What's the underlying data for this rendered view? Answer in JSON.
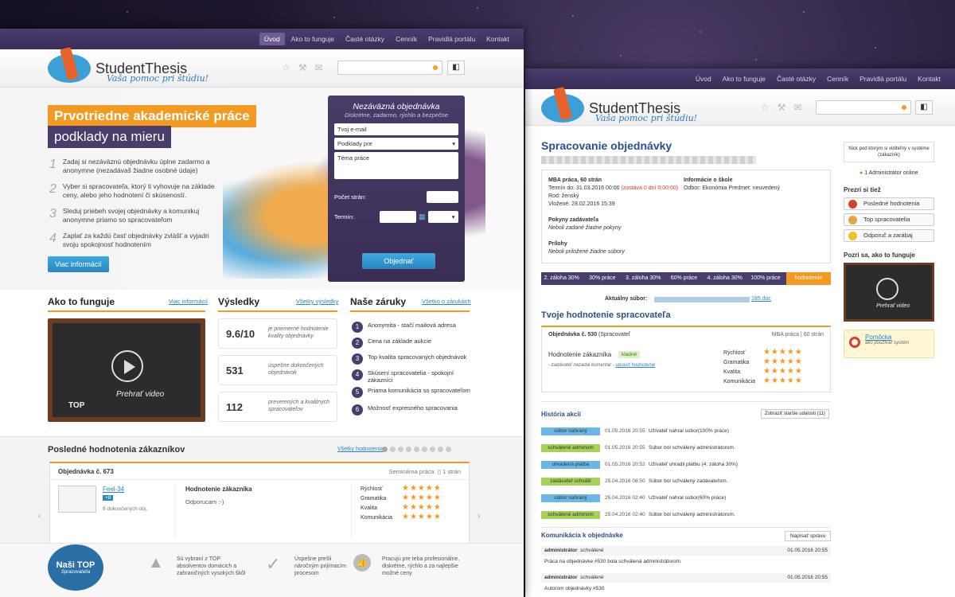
{
  "brand": {
    "name": "StudentThesis",
    "tagline": "Vaša pomoc pri štúdiu!"
  },
  "nav": [
    "Úvod",
    "Ako to funguje",
    "Časté otázky",
    "Cenník",
    "Pravidlá portálu",
    "Kontakt"
  ],
  "hero": {
    "title1": "Prvotriedne akademické práce",
    "title2": "podklady na mieru",
    "steps": [
      {
        "n": "1",
        "text": "Zadaj si nezáväznú objednávku úplne zadarmo a anonymne (nezadávaš žiadne osobné údaje)"
      },
      {
        "n": "2",
        "text": "Vyber si spracovateľa, ktorý ti vyhovuje na základe ceny, alebo jeho hodnotení či skúseností."
      },
      {
        "n": "3",
        "text": "Sleduj priebeh svojej objednávky a komunikuj anonymne priamo so spracovateľom"
      },
      {
        "n": "4",
        "text": "Zaplať za každú časť objednávky zvlášť a vyjadri svoju spokojnosť hodnotením"
      }
    ],
    "more_btn": "Viac informácií"
  },
  "order_form": {
    "title": "Nezáväzná objednávka",
    "subtitle": "Diskrétne, zadarmo, rýchlo a bezpečne",
    "email": "Tvoj e-mail",
    "type": "Podklady pre",
    "topic": "Téma práce",
    "pages_label": "Počet strán:",
    "deadline_label": "Termín:",
    "submit": "Objednať"
  },
  "how": {
    "title": "Ako to funguje",
    "link": "Viac informácií",
    "video_text": "Prehrať video",
    "badge": "TOP"
  },
  "results": {
    "title": "Výsledky",
    "link": "Všetky výsledky",
    "items": [
      {
        "value": "9.6/10",
        "desc": "je priemerné hodnotenie kvality objednávky"
      },
      {
        "value": "531",
        "desc": "úspešne dokončených objednávok"
      },
      {
        "value": "112",
        "desc": "preverených a kvalitných spracovateľov"
      }
    ]
  },
  "guarantees": {
    "title": "Naše záruky",
    "link": "Všetko o zárukách",
    "items": [
      "Anonymita - stačí mailová adresa",
      "Cena na základe aukcie",
      "Top kvalita spracovaných objednávok",
      "Skúsení spracovatelia - spokojní zákazníci",
      "Priama komunikácia so spracovateľom",
      "Možnosť expresného spracovania"
    ]
  },
  "last_reviews": {
    "title": "Posledné hodnotenia zákazníkov",
    "link": "Všetky hodnotenia",
    "order": "Objednávka č. 673",
    "type": "Seminárna práca",
    "pages": "1 strán",
    "user": "Feel-34",
    "user_badge": "+8",
    "completed": "8 dokončených obj.",
    "heading": "Hodnotenie zákazníka",
    "comment": "Odporucam :-)",
    "criteria": [
      "Rýchlosť",
      "Gramatika",
      "Kvalita",
      "Komunikácia"
    ]
  },
  "footer": {
    "top_badge": "Naši TOP",
    "top_sub": "Spracovatelia",
    "items": [
      "Sú vybraní z TOP absolventov domácich a zahraničných vysokých škôl",
      "Úspešne prešli náročným prijímacím procesom",
      "Pracujú pre teba profesionálne, diskrétne, rýchlo a za najlepšie možné ceny"
    ]
  },
  "p2": {
    "title": "Spracovanie objednávky",
    "order_type": "MBA práca, 60 strán",
    "deadline": "Termín do: 31.03.2016 00:00",
    "deadline_left": "(zostáva 0 dní 0:00:00)",
    "gender": "Rod: ženský",
    "inserted": "Vložené: 28.02.2016 15:39",
    "school_h": "Informácie o škole",
    "school": "Odbor: Ekonómia   Predmet: neuvedený",
    "instr_h": "Pokyny zadávateľa",
    "instr": "Neboli zadané žiadne pokyny",
    "att_h": "Prílohy",
    "att": "Neboli priložené žiadne súbory",
    "progress": [
      "2. záloha 30%",
      "30% práce",
      "3. záloha 30%",
      "60% práce",
      "4. záloha 30%",
      "100% práce",
      "hodnotenie"
    ],
    "current_file": "Aktuálny súbor:",
    "file_suffix": "185.doc",
    "rating_h": "Tvoje hodnotenie spracovateľa",
    "rating_order": "Objednávka č. 530",
    "rating_by": "(Spracovateľ",
    "rating_meta": "MBA práca | 60 strán",
    "cust_rating": "Hodnotenie zákazníka",
    "cust_badge": "kladné",
    "cust_comment": "- zadávateľ nezadal komentár -",
    "cust_edit": "upraviť hodnotenie",
    "criteria": [
      "Rýchlosť",
      "Gramatika",
      "Kvalita",
      "Komunikácia"
    ],
    "history_h": "História akcií",
    "history_btn": "Zobraziť staršie udalosti (11)",
    "history": [
      {
        "tag": "súbor nahraný",
        "color": "#6ab8e8",
        "date": "01.05.2016 20:55",
        "text": "Užívateľ nahral súbor(100% práce)"
      },
      {
        "tag": "schválené adminom",
        "color": "#a6d25a",
        "date": "01.05.2016 20:55",
        "text": "Súbor bol schválený administrátorom."
      },
      {
        "tag": "uhradená platba",
        "color": "#6ab8e8",
        "date": "01.05.2016 20:52",
        "text": "Užívateľ uhradil platbu (4. záloha 30%)"
      },
      {
        "tag": "zadávateľ schválil",
        "color": "#a6d25a",
        "date": "25.04.2016 08:50",
        "text": "Súbor bol schválený zadávateľom."
      },
      {
        "tag": "súbor nahraný",
        "color": "#6ab8e8",
        "date": "25.04.2016 02:40",
        "text": "Užívateľ nahral súbor(60% práce)"
      },
      {
        "tag": "schválené adminom",
        "color": "#a6d25a",
        "date": "25.04.2016 02:40",
        "text": "Súbor bol schválený administrátorom."
      }
    ],
    "comm_h": "Komunikácia k objednávke",
    "comm_btn": "Napísať správu",
    "msgs": [
      {
        "from": "administrátor",
        "status": "schválené",
        "date": "01.05.2016 20:55",
        "text": "Práca na objednávke #530 bola schválená administrátorom."
      },
      {
        "from": "administrátor",
        "status": "schválené",
        "date": "01.05.2016 20:55",
        "text": "Autorom objednávky #530"
      }
    ],
    "nick_note": "Nick pod ktorým si viditeľný v systéme",
    "nick_suffix": "(zákazník)",
    "online": "1 Administrátor online",
    "browse_h": "Prezri si tiež",
    "browse": [
      "Posledné hodnotenia",
      "Top spracovatelia",
      "Odporuč a zarábaj"
    ],
    "how_h": "Pozri sa, ako to funguje",
    "video_text": "Prehrať video",
    "help": "Pomôcka",
    "help_sub": "ako používať systém"
  }
}
